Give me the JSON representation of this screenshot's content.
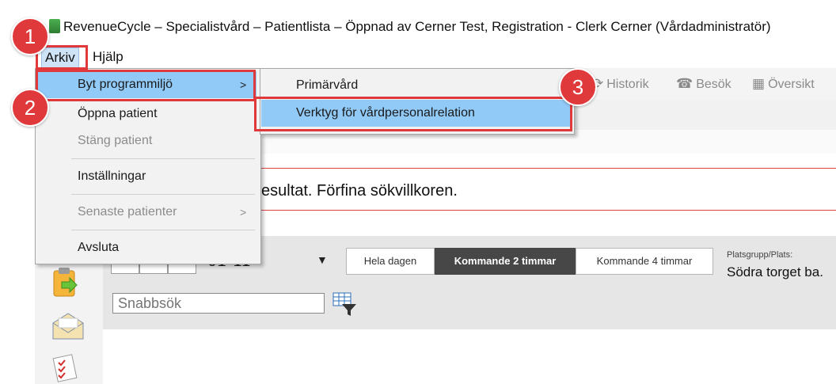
{
  "window": {
    "title": "RevenueCycle – Specialistvård – Patientlista – Öppnad av Cerner Test, Registration - Clerk Cerner (Vårdadministratör)"
  },
  "menubar": {
    "items": [
      {
        "label": "Arkiv"
      },
      {
        "label": "Hjälp"
      }
    ]
  },
  "file_menu": {
    "items": [
      {
        "label": "Byt programmiljö",
        "submenu_arrow": ">"
      },
      {
        "label": "Öppna patient"
      },
      {
        "label": "Stäng patient"
      },
      {
        "label": "Inställningar"
      },
      {
        "label": "Senaste patienter",
        "submenu_arrow": ">"
      },
      {
        "label": "Avsluta"
      }
    ]
  },
  "submenu": {
    "items": [
      {
        "label": "Primärvård"
      },
      {
        "label": "Verktyg för vårdpersonalrelation"
      }
    ]
  },
  "toolbar": {
    "items": [
      {
        "label": "Historik",
        "icon": "history-icon"
      },
      {
        "label": "Besök",
        "icon": "visit-icon"
      },
      {
        "label": "Översikt",
        "icon": "overview-icon"
      }
    ]
  },
  "message": {
    "text": "esultat. Förfina sökvillkoren."
  },
  "schedule": {
    "date": "01-11",
    "ranges": [
      {
        "label": "Hela dagen"
      },
      {
        "label": "Kommande 2 timmar"
      },
      {
        "label": "Kommande 4 timmar"
      }
    ],
    "place_label": "Platsgrupp/Plats:",
    "place_value": "Södra torget ba.",
    "search_placeholder": "Snabbsök"
  },
  "annotations": {
    "steps": [
      "1",
      "2",
      "3"
    ]
  },
  "colors": {
    "annotation_red": "#e0393b",
    "menu_highlight": "#91c9f7",
    "selected_range": "#474747"
  }
}
